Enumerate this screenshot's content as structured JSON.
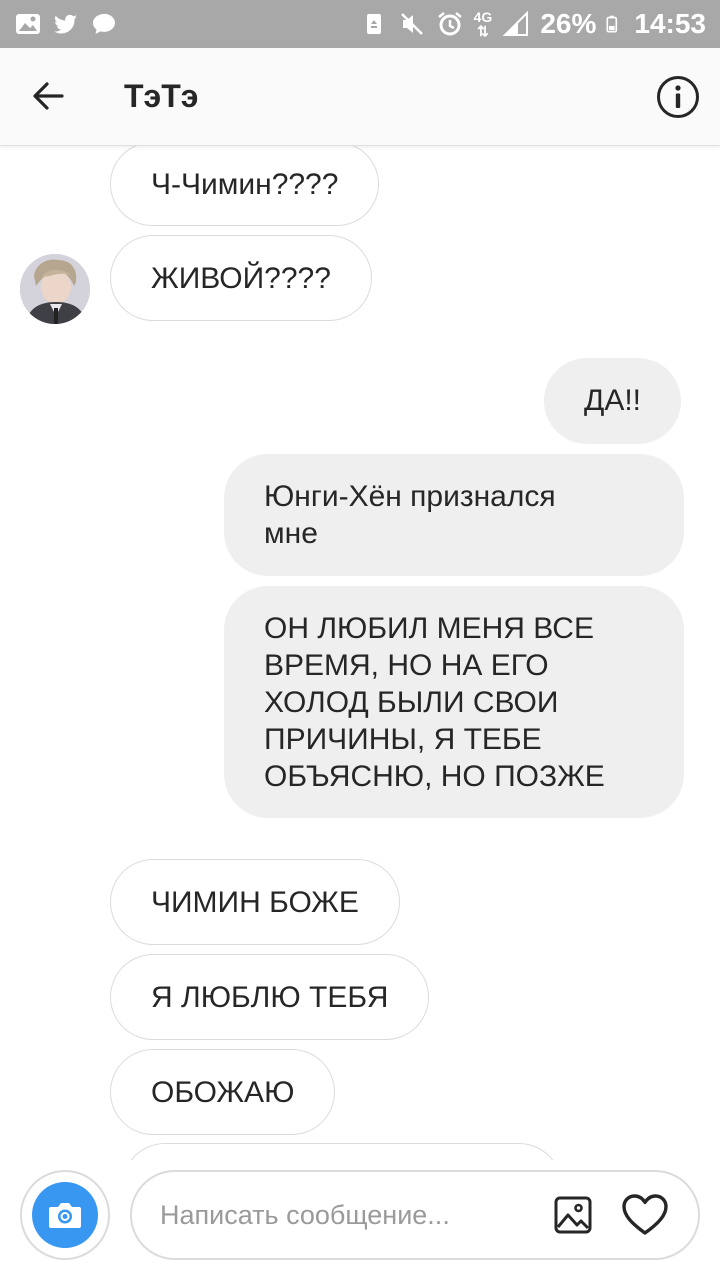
{
  "status_bar": {
    "battery_percent": "26%",
    "time": "14:53",
    "network": "4G",
    "icons": [
      "gallery-icon",
      "twitter-icon",
      "chat-icon",
      "recycle-icon",
      "mute-icon",
      "alarm-icon",
      "signal-icon",
      "battery-icon"
    ]
  },
  "header": {
    "title": "ТэТэ",
    "back_icon": "arrow-left-icon",
    "info_icon": "info-icon"
  },
  "messages": [
    {
      "side": "incoming",
      "text": "Ч-Чимин????"
    },
    {
      "side": "incoming",
      "text": "ЖИВОЙ????"
    },
    {
      "side": "outgoing",
      "text": "ДА!!"
    },
    {
      "side": "outgoing",
      "text": "Юнги-Хён признался\nмне"
    },
    {
      "side": "outgoing",
      "text": "ОН ЛЮБИЛ МЕНЯ ВСЕ\nВРЕМЯ, НО НА ЕГО\nХОЛОД БЫЛИ СВОИ\nПРИЧИНЫ, Я ТЕБЕ\nОБЪЯСНЮ, НО ПОЗЖЕ"
    },
    {
      "side": "incoming",
      "text": "ЧИМИН БОЖЕ"
    },
    {
      "side": "incoming",
      "text": "Я ЛЮБЛЮ ТЕБЯ"
    },
    {
      "side": "incoming",
      "text": "ОБОЖАЮ"
    },
    {
      "side": "incoming",
      "text": ""
    }
  ],
  "composer": {
    "placeholder": "Написать сообщение...",
    "camera_icon": "camera-icon",
    "gallery_icon": "image-icon",
    "heart_icon": "heart-icon"
  },
  "colors": {
    "status_bar": "#a8a8a8",
    "outgoing_bubble": "#efefef",
    "incoming_border": "#dbdbdb",
    "accent": "#3897f0"
  }
}
